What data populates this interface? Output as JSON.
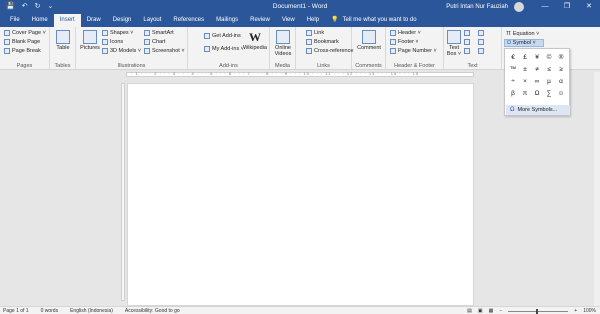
{
  "titlebar": {
    "title": "Document1 - Word",
    "user": "Putri Intan Nur Fauziah",
    "minimize": "—",
    "restore": "❐",
    "close": "✕",
    "qat": [
      "💾",
      "↶",
      "↻",
      "⌄"
    ]
  },
  "tabs": [
    "File",
    "Home",
    "Insert",
    "Draw",
    "Design",
    "Layout",
    "References",
    "Mailings",
    "Review",
    "View",
    "Help"
  ],
  "active_tab": "Insert",
  "tell_me": "Tell me what you want to do",
  "ribbon": {
    "pages": {
      "cover": "Cover Page ˅",
      "blank": "Blank Page",
      "break": "Page Break",
      "label": "Pages"
    },
    "tables": {
      "table": "Table",
      "label": "Tables"
    },
    "illustrations": {
      "pictures": "Pictures",
      "shapes": "Shapes ˅",
      "icons": "Icons",
      "models": "3D Models ˅",
      "smartart": "SmartArt",
      "chart": "Chart",
      "screenshot": "Screenshot ˅",
      "label": "Illustrations"
    },
    "addins": {
      "get": "Get Add-ins",
      "my": "My Add-ins ˅",
      "wikipedia": "Wikipedia",
      "label": "Add-ins"
    },
    "media": {
      "video": "Online Videos",
      "label": "Media"
    },
    "links": {
      "link": "Link",
      "bookmark": "Bookmark",
      "cross": "Cross-reference",
      "label": "Links"
    },
    "comments": {
      "comment": "Comment",
      "label": "Comments"
    },
    "header_footer": {
      "header": "Header ˅",
      "footer": "Footer ˅",
      "page_number": "Page Number ˅",
      "label": "Header & Footer"
    },
    "text": {
      "textbox": "Text Box ˅",
      "label": "Text"
    },
    "symbols": {
      "equation": "Equation ˅",
      "symbol": "Symbol ˅"
    }
  },
  "symbol_panel": {
    "symbols": [
      "€",
      "£",
      "¥",
      "©",
      "®",
      "™",
      "±",
      "≠",
      "≤",
      "≥",
      "÷",
      "×",
      "∞",
      "µ",
      "α",
      "β",
      "π",
      "Ω",
      "∑",
      "☺"
    ],
    "more": "More Symbols..."
  },
  "statusbar": {
    "page": "Page 1 of 1",
    "words": "0 words",
    "language": "English (Indonesia)",
    "accessibility": "Accessibility: Good to go",
    "zoom": "100%"
  }
}
